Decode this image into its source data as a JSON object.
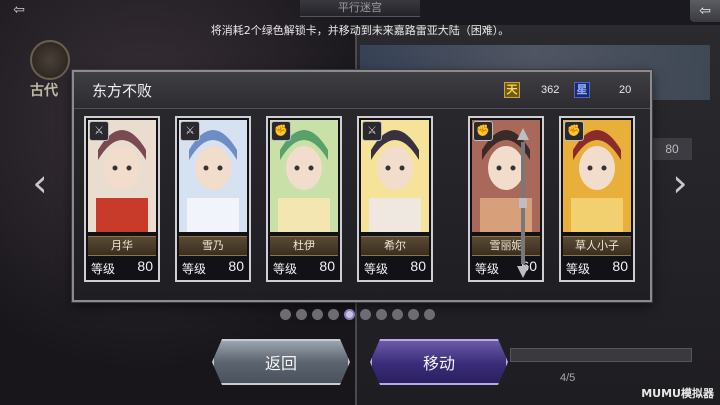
{
  "header": {
    "title": "平行迷宫",
    "back_icon": "back-arrow-icon",
    "close_icon": "close-icon"
  },
  "background": {
    "era_label": "古代",
    "side_value": "80",
    "progress_count": "4/5"
  },
  "message": "将消耗2个绿色解锁卡，并移动到未来嘉路雷亚大陆（困难）。",
  "dialog": {
    "team_name": "东方不败",
    "resources": [
      {
        "icon": "天",
        "value": "362",
        "color": "#ffd84a"
      },
      {
        "icon": "星",
        "value": "20",
        "color": "#8fb0ff"
      }
    ],
    "level_label": "等级",
    "cards": [
      {
        "name": "月华",
        "level": "80",
        "class_icon": "sword-icon",
        "colors": [
          "#e9ddd0",
          "#7a4a52",
          "#c83a2a"
        ]
      },
      {
        "name": "雪乃",
        "level": "80",
        "class_icon": "sword-icon",
        "colors": [
          "#d6e2f2",
          "#6d8dc4",
          "#f1f4fa"
        ]
      },
      {
        "name": "杜伊",
        "level": "80",
        "class_icon": "fist-icon",
        "colors": [
          "#c9e0a8",
          "#5aa06a",
          "#f3e6b0"
        ]
      },
      {
        "name": "希尔",
        "level": "80",
        "class_icon": "sword-icon",
        "colors": [
          "#f6e39a",
          "#3a3040",
          "#efe8e0"
        ]
      },
      {
        "name": "雪丽妮",
        "level": "60",
        "class_icon": "fist-icon",
        "colors": [
          "#a8685a",
          "#3a2a28",
          "#d8a07a"
        ]
      },
      {
        "name": "草人小子",
        "level": "80",
        "class_icon": "fist-icon",
        "colors": [
          "#e8b03a",
          "#8a2a2a",
          "#f2d070"
        ]
      }
    ],
    "page_dots": 10,
    "active_dot": 4
  },
  "buttons": {
    "back_label": "返回",
    "move_label": "移动"
  },
  "watermark": "MUMU模拟器"
}
